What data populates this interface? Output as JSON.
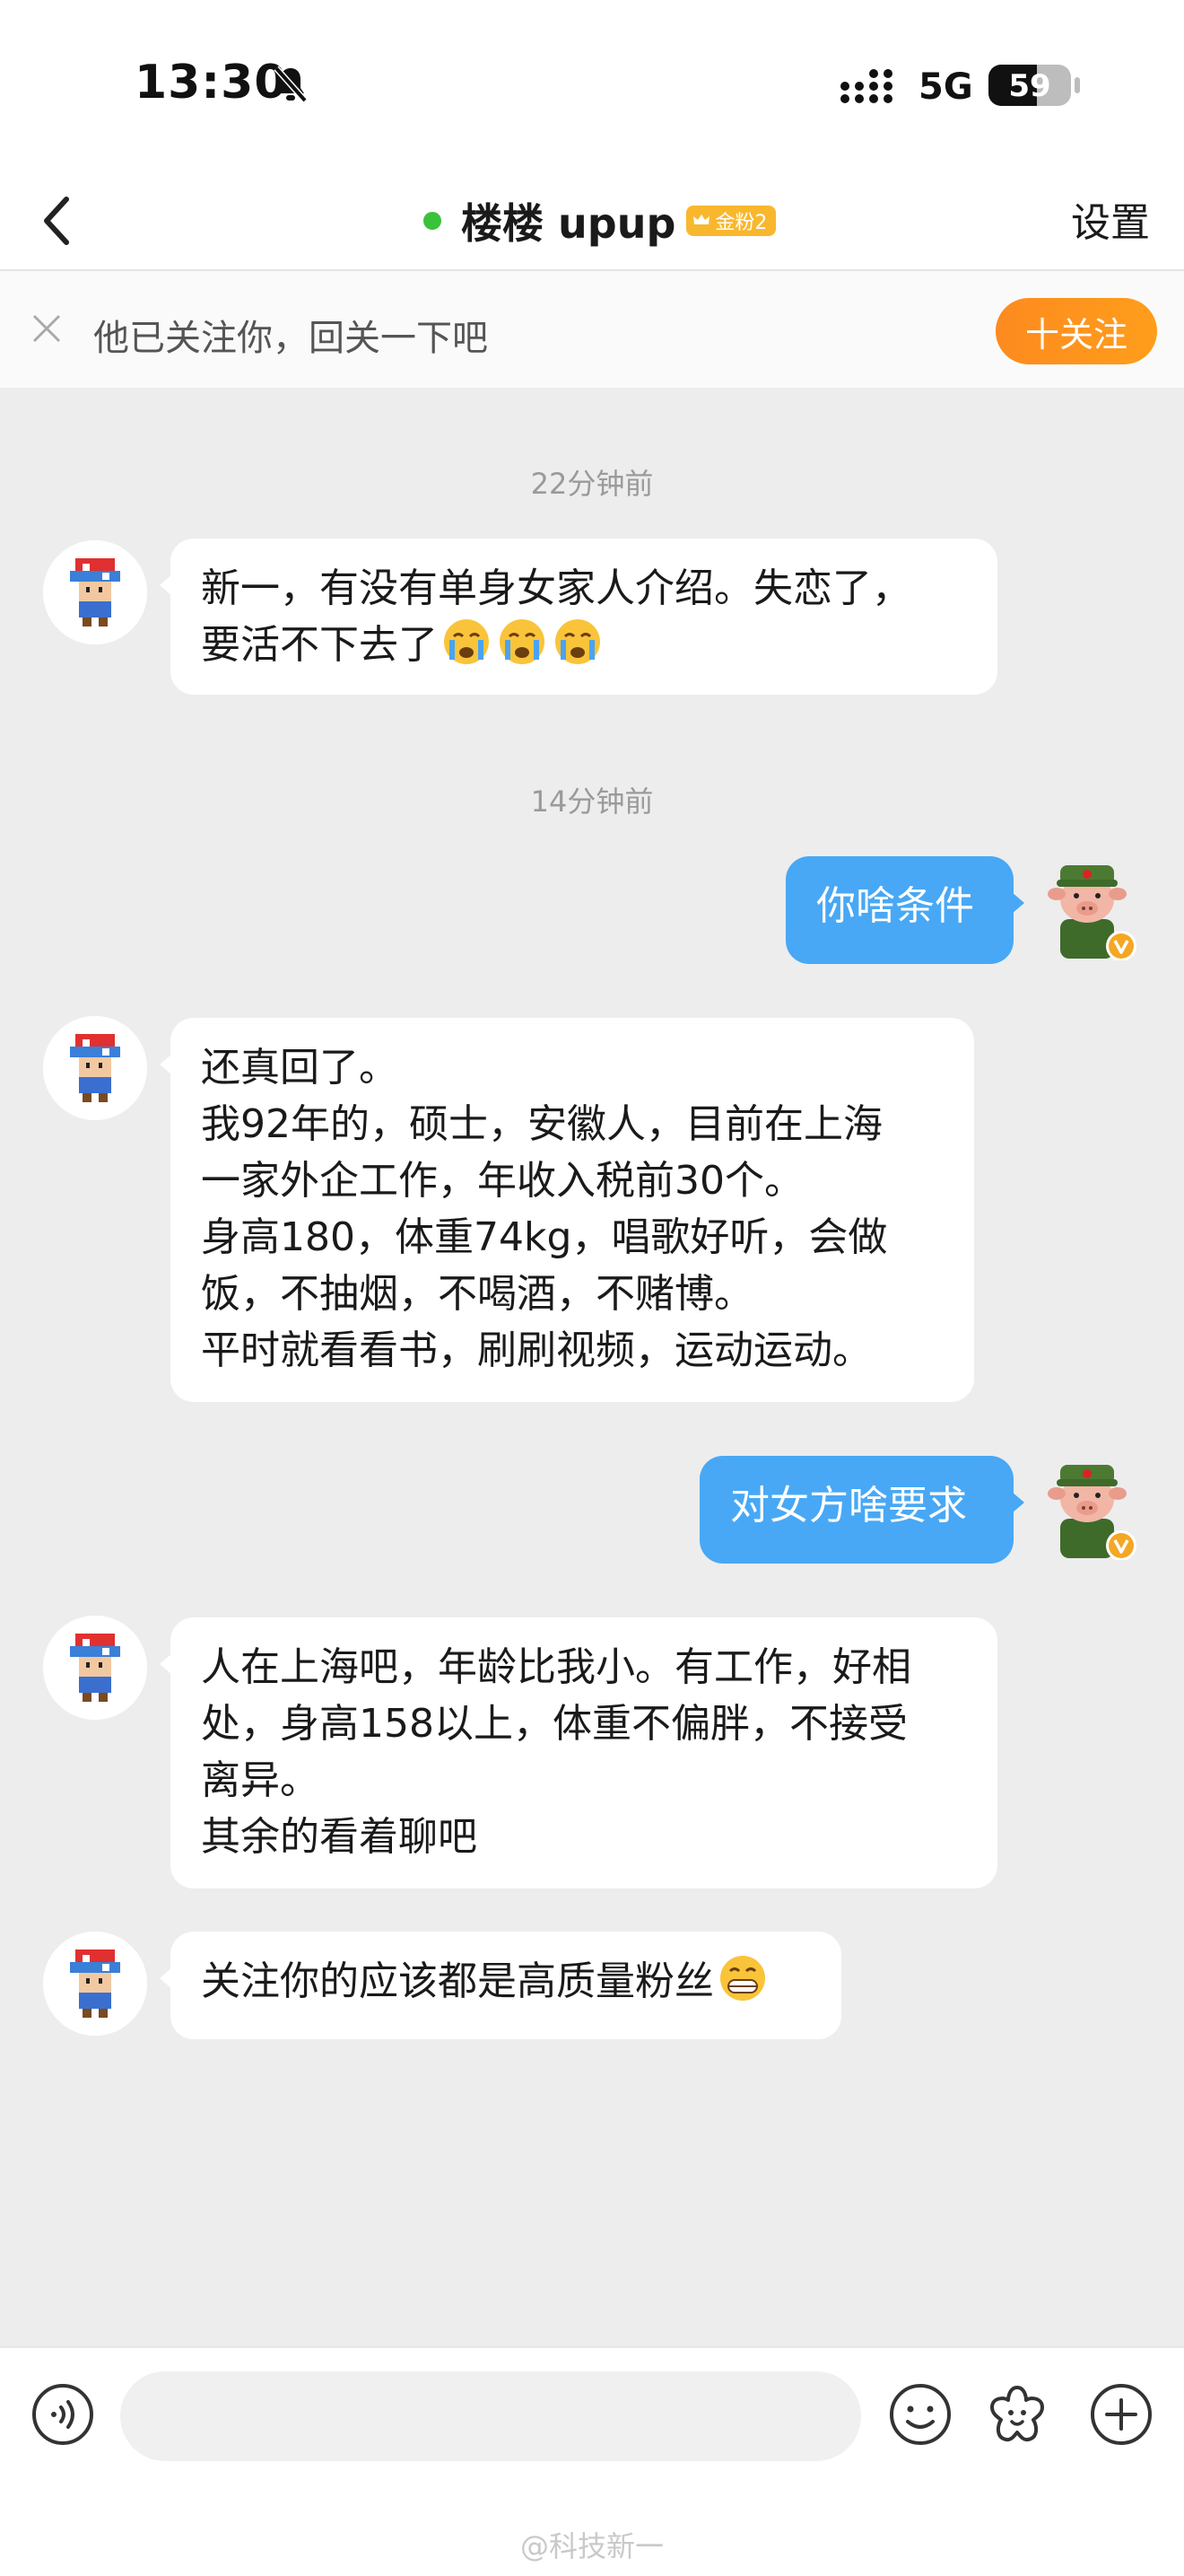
{
  "status_bar": {
    "time": "13:30",
    "network": "5G",
    "battery": "59",
    "battery_level": 0.59
  },
  "nav": {
    "title": "楼楼 upup",
    "badge": "金粉2",
    "settings": "设置"
  },
  "banner": {
    "text": "他已关注你，回关一下吧",
    "follow_button": "十关注"
  },
  "messages": {
    "ts1": "22分钟前",
    "m1_l1": "新一，有没有单身女家人介绍。失恋了，",
    "m1_l2": "要活不下去了",
    "ts2": "14分钟前",
    "m2": "你啥条件",
    "m3_l1": "还真回了。",
    "m3_l2": "我92年的，硕士，安徽人，目前在上海",
    "m3_l3": "一家外企工作，年收入税前30个。",
    "m3_l4": "身高180，体重74kg，唱歌好听，会做",
    "m3_l5": "饭，不抽烟，不喝酒，不赌博。",
    "m3_l6": "平时就看看书，刷刷视频，运动运动。",
    "m4": "对女方啥要求",
    "m5_l1": "人在上海吧，年龄比我小。有工作，好相",
    "m5_l2": "处，身高158以上，体重不偏胖，不接受",
    "m5_l3": "离异。",
    "m5_l4": "其余的看着聊吧",
    "m6": "关注你的应该都是高质量粉丝"
  },
  "input_bar": {
    "placeholder": ""
  },
  "watermark": "@科技新一",
  "colors": {
    "accent_orange": "#fd8a1f",
    "bubble_blue": "#48a8f5",
    "online_green": "#3ac23a",
    "badge_gold": "#f9b72e"
  }
}
